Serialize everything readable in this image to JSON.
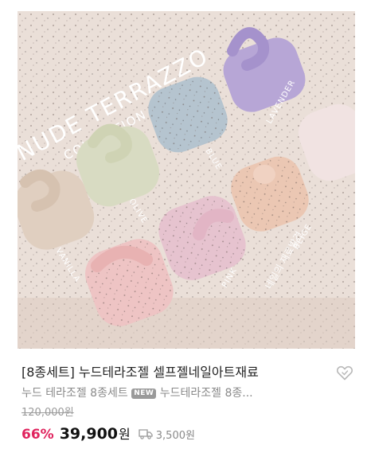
{
  "product": {
    "image_alt": "누드테라조젤 8종 컬렉션 제품 사진",
    "photo_text": {
      "collection_title": "NUDE TERRAZZO",
      "collection_sub": "COLLECTION",
      "colors": [
        "VANILLA",
        "OLIVE",
        "BLUE",
        "LAVENDER",
        "PINK",
        "BEIGE"
      ],
      "brand_stamp": "네일의 재료발견"
    },
    "title": "[8종세트] 누드테라조젤 셀프젤네일아트재료",
    "subtitle_before": "누드 테라조젤 8종세트 ",
    "new_badge": "NEW",
    "subtitle_after": " 누드테라조젤 8종...",
    "original_price": "120,000원",
    "discount": "66%",
    "price": "39,900",
    "price_unit": "원",
    "shipping_fee": "3,500원"
  },
  "colors": {
    "accent": "#e0245e",
    "text": "#222222",
    "muted": "#8a8a8a"
  },
  "icons": {
    "wishlist": "heart-outline-icon",
    "shipping": "truck-icon"
  }
}
